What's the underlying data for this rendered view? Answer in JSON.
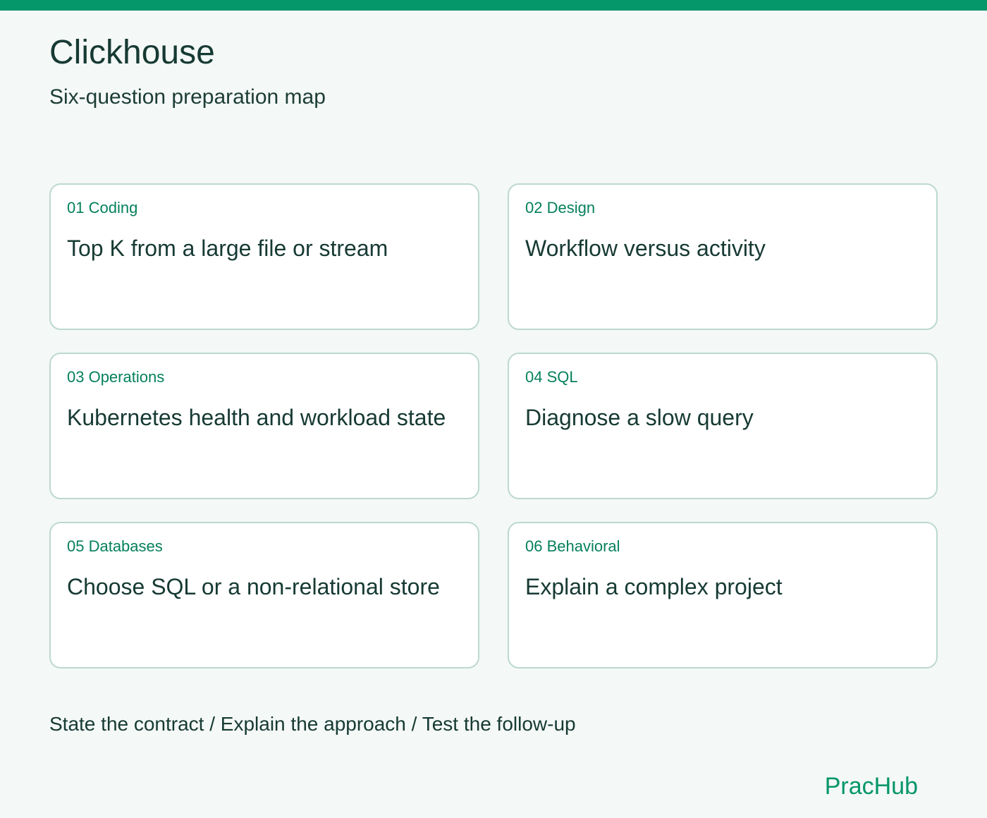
{
  "header": {
    "title": "Clickhouse",
    "subtitle": "Six-question preparation map"
  },
  "cards": [
    {
      "tag": "01 Coding",
      "question": "Top K from a large file or stream"
    },
    {
      "tag": "02 Design",
      "question": "Workflow versus activity"
    },
    {
      "tag": "03 Operations",
      "question": "Kubernetes health and workload state"
    },
    {
      "tag": "04 SQL",
      "question": "Diagnose a slow query"
    },
    {
      "tag": "05 Databases",
      "question": "Choose SQL or a non-relational store"
    },
    {
      "tag": "06 Behavioral",
      "question": "Explain a complex project"
    }
  ],
  "footer": {
    "note": "State the contract / Explain the approach / Test the follow-up",
    "brand": "PracHub"
  },
  "colors": {
    "accent": "#05966a",
    "background": "#f4f8f6",
    "card_border": "#bcd9cf",
    "text": "#163a33"
  }
}
